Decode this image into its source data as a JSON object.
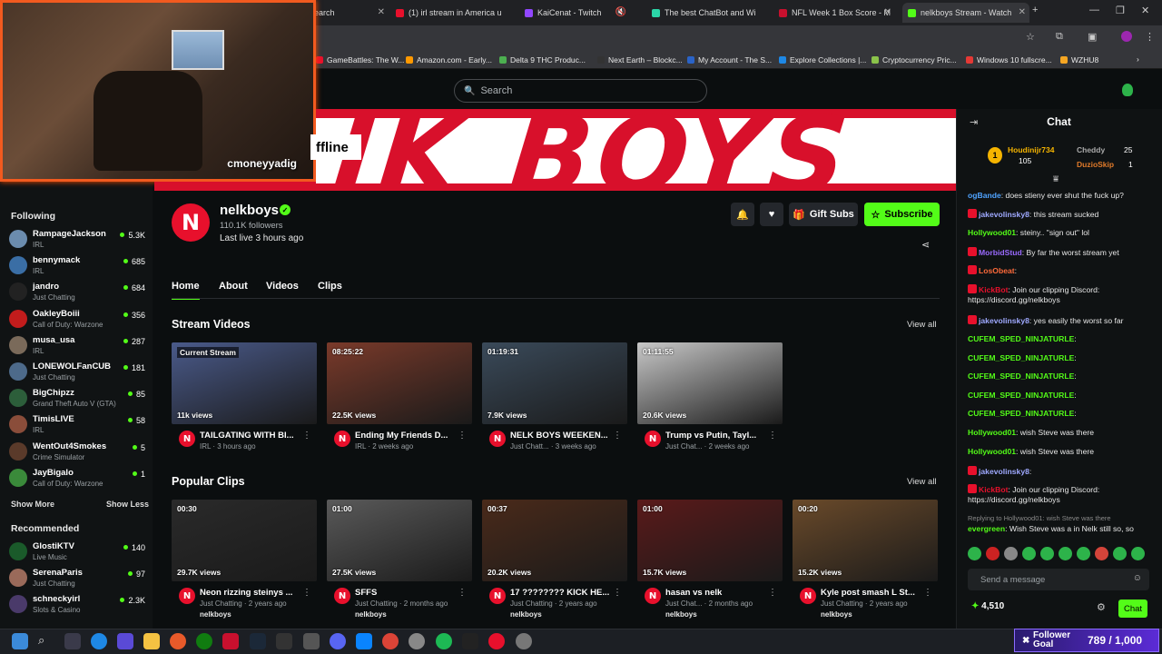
{
  "browser": {
    "tabs": [
      {
        "label": "earch",
        "color": "#8ab4f8"
      },
      {
        "label": "(1) irl stream in America u",
        "color": "#e8102c"
      },
      {
        "label": "KaiCenat - Twitch",
        "color": "#9147ff"
      },
      {
        "label": "The best ChatBot and Wi",
        "color": "#2bd7a8"
      },
      {
        "label": "NFL Week 1 Box Score - M",
        "color": "#c8102e"
      },
      {
        "label": "nelkboys Stream - Watch",
        "color": "#53fc18"
      }
    ],
    "bookmarks": [
      {
        "label": "GameBattles: The W...",
        "color": "#e8102c"
      },
      {
        "label": "Amazon.com - Early...",
        "color": "#ff9900"
      },
      {
        "label": "Delta 9 THC Produc...",
        "color": "#4caf50"
      },
      {
        "label": "Next Earth – Blockc...",
        "color": "#333333"
      },
      {
        "label": "My Account - The S...",
        "color": "#2a63c7"
      },
      {
        "label": "Explore Collections |...",
        "color": "#1e88e5"
      },
      {
        "label": "Cryptocurrency Pric...",
        "color": "#8bc34a"
      },
      {
        "label": "Windows 10 fullscre...",
        "color": "#e53935"
      },
      {
        "label": "WZHU8",
        "color": "#f5a623"
      }
    ]
  },
  "webcam": {
    "name": "cmoneyyadig"
  },
  "search": {
    "placeholder": "Search"
  },
  "banner": {
    "text": "IK BOYS",
    "offline_label": "ffline"
  },
  "channel": {
    "name": "nelkboys",
    "avatar_letter": "N",
    "followers": "110.1K followers",
    "last_live": "Last live 3 hours ago",
    "gift_subs": "Gift Subs",
    "subscribe": "Subscribe"
  },
  "nav": {
    "home": "Home",
    "about": "About",
    "videos": "Videos",
    "clips": "Clips"
  },
  "sidebar": {
    "following_title": "Following",
    "following": [
      {
        "name": "RampageJackson",
        "category": "IRL",
        "viewers": "5.3K",
        "color": "#6b8cae"
      },
      {
        "name": "bennymack",
        "category": "IRL",
        "viewers": "685",
        "color": "#3a6ea5"
      },
      {
        "name": "jandro",
        "category": "Just Chatting",
        "viewers": "684",
        "color": "#222"
      },
      {
        "name": "OakleyBoiii",
        "category": "Call of Duty: Warzone",
        "viewers": "356",
        "color": "#c21c1c"
      },
      {
        "name": "musa_usa",
        "category": "IRL",
        "viewers": "287",
        "color": "#7a6a5a"
      },
      {
        "name": "LONEWOLFanCUB",
        "category": "Just Chatting",
        "viewers": "181",
        "color": "#4d6a8a"
      },
      {
        "name": "BigChipzz",
        "category": "Grand Theft Auto V (GTA)",
        "viewers": "85",
        "color": "#2c5e3a"
      },
      {
        "name": "TimisLIVE",
        "category": "IRL",
        "viewers": "58",
        "color": "#8a4d3a"
      },
      {
        "name": "WentOut4Smokes",
        "category": "Crime Simulator",
        "viewers": "5",
        "color": "#5a3a2a"
      },
      {
        "name": "JayBigalo",
        "category": "Call of Duty: Warzone",
        "viewers": "1",
        "color": "#3a8a3a"
      }
    ],
    "show_more": "Show More",
    "show_less": "Show Less",
    "recommended_title": "Recommended",
    "recommended": [
      {
        "name": "GlostiKTV",
        "category": "Live Music",
        "viewers": "140",
        "color": "#1a5a2a"
      },
      {
        "name": "SerenaParis",
        "category": "Just Chatting",
        "viewers": "97",
        "color": "#9a6a5a"
      },
      {
        "name": "schneckyirl",
        "category": "Slots & Casino",
        "viewers": "2.3K",
        "color": "#4a3a6a"
      }
    ]
  },
  "stream_videos": {
    "title": "Stream Videos",
    "view_all": "View all",
    "items": [
      {
        "tag": "Current Stream",
        "views": "11k views",
        "title": "TAILGATING WITH BI...",
        "meta": "IRL · 3 hours ago",
        "bg": "#4a5a8a"
      },
      {
        "tag": "08:25:22",
        "views": "22.5K views",
        "title": "Ending My Friends D...",
        "meta": "IRL · 2 weeks ago",
        "bg": "#7a3a2a"
      },
      {
        "tag": "01:19:31",
        "views": "7.9K views",
        "title": "NELK BOYS WEEKEN...",
        "meta": "Just Chatt... · 3 weeks ago",
        "bg": "#3a4a5a"
      },
      {
        "tag": "01:11:55",
        "views": "20.6K views",
        "title": "Trump vs Putin, Tayl...",
        "meta": "Just Chat... · 2 weeks ago",
        "bg": "#c8c8c8"
      }
    ]
  },
  "popular_clips": {
    "title": "Popular Clips",
    "view_all": "View all",
    "items": [
      {
        "tag": "00:30",
        "views": "29.7K views",
        "title": "Neon rizzing steinys ...",
        "meta": "Just Chatting · 2 years ago",
        "channel": "nelkboys",
        "bg": "#2a2a2a"
      },
      {
        "tag": "01:00",
        "views": "27.5K views",
        "title": "SFFS",
        "meta": "Just Chatting · 2 months ago",
        "channel": "nelkboys",
        "bg": "#5a5a5a"
      },
      {
        "tag": "00:37",
        "views": "20.2K views",
        "title": "17 ???????? KICK HE...",
        "meta": "Just Chatting · 2 years ago",
        "channel": "nelkboys",
        "bg": "#4a2a1a"
      },
      {
        "tag": "01:00",
        "views": "15.7K views",
        "title": "hasan vs nelk",
        "meta": "Just Chat... · 2 months ago",
        "channel": "nelkboys",
        "bg": "#5a1a1a"
      },
      {
        "tag": "00:20",
        "views": "15.2K views",
        "title": "Kyle post smash L St...",
        "meta": "Just Chatting · 2 years ago",
        "channel": "nelkboys",
        "bg": "#6a4a2a"
      }
    ]
  },
  "chat": {
    "title": "Chat",
    "top_users": [
      {
        "name": "Houdinijr734",
        "count": "105"
      },
      {
        "name": "Cheddy",
        "count": "25"
      },
      {
        "name": "DuzioSkip",
        "count": "1"
      }
    ],
    "messages": [
      {
        "user": "ogBande",
        "color": "#4fa3ff",
        "text": ": does stieny ever shut the fuck up?"
      },
      {
        "user": "jakevolinsky8",
        "color": "#9fa9ff",
        "text": ": this stream sucked"
      },
      {
        "user": "Hollywood01",
        "color": "#53fc18",
        "text": ": steiny.. \"sign out\" lol"
      },
      {
        "user": "MorbidStud",
        "color": "#9a6aff",
        "text": ": By far the worst stream yet"
      },
      {
        "user": "LosObeat",
        "color": "#ff6a3a",
        "text": ":"
      },
      {
        "user": "KickBot",
        "color": "#e8102c",
        "text": ": Join our clipping Discord: https://discord.gg/nelkboys"
      },
      {
        "user": "jakevolinsky8",
        "color": "#9fa9ff",
        "text": ": yes easily the worst so far"
      },
      {
        "user": "CUFEM_SPED_NINJATURLE",
        "color": "#53fc18",
        "text": ":"
      },
      {
        "user": "CUFEM_SPED_NINJATURLE",
        "color": "#53fc18",
        "text": ":"
      },
      {
        "user": "CUFEM_SPED_NINJATURLE",
        "color": "#53fc18",
        "text": ":"
      },
      {
        "user": "CUFEM_SPED_NINJATURLE",
        "color": "#53fc18",
        "text": ":"
      },
      {
        "user": "CUFEM_SPED_NINJATURLE",
        "color": "#53fc18",
        "text": ":"
      },
      {
        "user": "Hollywood01",
        "color": "#53fc18",
        "text": ": wish Steve was there"
      },
      {
        "user": "Hollywood01",
        "color": "#53fc18",
        "text": ": wish Steve was there"
      },
      {
        "user": "jakevolinsky8",
        "color": "#9fa9ff",
        "text": ":"
      },
      {
        "user": "KickBot",
        "color": "#e8102c",
        "text": ": Join our clipping Discord: https://discord.gg/nelkboys"
      }
    ],
    "reply_note": "Replying to Hollywood01: wish Steve was there",
    "last_msg_user": "evergreen",
    "last_msg_text": ": Wish Steve was a in Nelk still so, so",
    "input_placeholder": "Send a message",
    "points": "4,510",
    "send_label": "Chat"
  },
  "follower_goal": {
    "label": "Follower Goal",
    "value": "789 / 1,000"
  }
}
